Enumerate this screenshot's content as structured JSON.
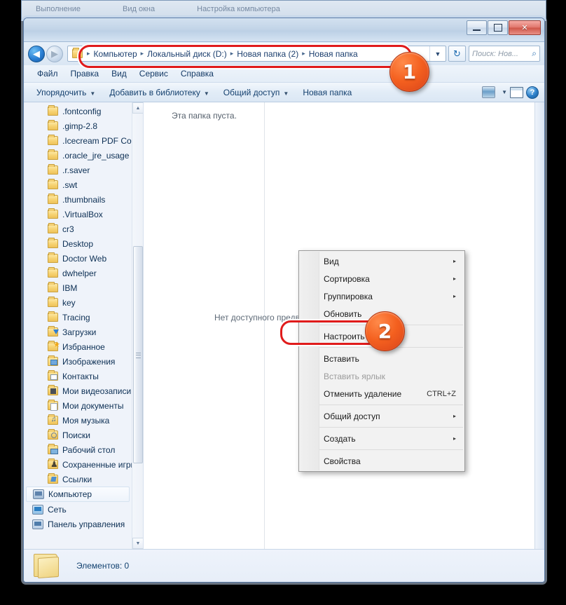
{
  "background_window": {
    "fragments": [
      "Выполнение",
      "Вид окна",
      "Настройка компьютера"
    ]
  },
  "window": {
    "controls": {
      "minimize": "minimize-button",
      "maximize": "maximize-button",
      "close": "✕"
    }
  },
  "navbar": {
    "back": "◀",
    "forward": "▶",
    "breadcrumbs": [
      "Компьютер",
      "Локальный диск (D:)",
      "Новая папка (2)",
      "Новая папка"
    ],
    "separator": "▸",
    "dropdown": "▼",
    "refresh": "↻",
    "search_placeholder": "Поиск: Нов...",
    "search_value": "",
    "search_icon": "⌕"
  },
  "menubar": [
    "Файл",
    "Правка",
    "Вид",
    "Сервис",
    "Справка"
  ],
  "commandbar": {
    "items": [
      {
        "label": "Упорядочить",
        "caret": "▼"
      },
      {
        "label": "Добавить в библиотеку",
        "caret": "▼"
      },
      {
        "label": "Общий доступ",
        "caret": "▼"
      },
      {
        "label": "Новая папка",
        "caret": ""
      }
    ],
    "view_caret": "▼",
    "help_label": "?"
  },
  "navpane": {
    "items": [
      {
        "label": ".fontconfig",
        "icon": "folder"
      },
      {
        "label": ".gimp-2.8",
        "icon": "folder"
      },
      {
        "label": ".Icecream PDF Con",
        "icon": "folder"
      },
      {
        "label": ".oracle_jre_usage",
        "icon": "folder"
      },
      {
        "label": ".r.saver",
        "icon": "folder"
      },
      {
        "label": ".swt",
        "icon": "folder"
      },
      {
        "label": ".thumbnails",
        "icon": "folder"
      },
      {
        "label": ".VirtualBox",
        "icon": "folder"
      },
      {
        "label": "cr3",
        "icon": "folder"
      },
      {
        "label": "Desktop",
        "icon": "folder"
      },
      {
        "label": "Doctor Web",
        "icon": "folder"
      },
      {
        "label": "dwhelper",
        "icon": "folder"
      },
      {
        "label": "IBM",
        "icon": "folder"
      },
      {
        "label": "key",
        "icon": "folder"
      },
      {
        "label": "Tracing",
        "icon": "folder"
      },
      {
        "label": "Загрузки",
        "icon": "downloads"
      },
      {
        "label": "Избранное",
        "icon": "favorites"
      },
      {
        "label": "Изображения",
        "icon": "pictures"
      },
      {
        "label": "Контакты",
        "icon": "contacts"
      },
      {
        "label": "Мои видеозаписи",
        "icon": "videos"
      },
      {
        "label": "Мои документы",
        "icon": "documents"
      },
      {
        "label": "Моя музыка",
        "icon": "music"
      },
      {
        "label": "Поиски",
        "icon": "searches"
      },
      {
        "label": "Рабочий стол",
        "icon": "desktop"
      },
      {
        "label": "Сохраненные игры",
        "icon": "games"
      },
      {
        "label": "Ссылки",
        "icon": "links"
      }
    ],
    "roots": [
      {
        "label": "Компьютер",
        "icon": "computer",
        "selected": true
      },
      {
        "label": "Сеть",
        "icon": "network",
        "selected": false
      },
      {
        "label": "Панель управления",
        "icon": "control-panel",
        "selected": false
      }
    ],
    "scroll_up": "▲",
    "scroll_down": "▼"
  },
  "content": {
    "empty_text": "Эта папка пуста.",
    "preview_text": "Нет доступного предварительного просмотра."
  },
  "details": {
    "item_count": "Элементов: 0"
  },
  "context_menu": {
    "items": [
      {
        "label": "Вид",
        "submenu": true,
        "disabled": false,
        "accel": ""
      },
      {
        "label": "Сортировка",
        "submenu": true,
        "disabled": false,
        "accel": ""
      },
      {
        "label": "Группировка",
        "submenu": true,
        "disabled": false,
        "accel": ""
      },
      {
        "label": "Обновить",
        "submenu": false,
        "disabled": false,
        "accel": ""
      },
      {
        "separator": true
      },
      {
        "label": "Настроить папку...",
        "submenu": false,
        "disabled": false,
        "accel": ""
      },
      {
        "separator": true
      },
      {
        "label": "Вставить",
        "submenu": false,
        "disabled": false,
        "accel": ""
      },
      {
        "label": "Вставить ярлык",
        "submenu": false,
        "disabled": true,
        "accel": ""
      },
      {
        "label": "Отменить удаление",
        "submenu": false,
        "disabled": false,
        "accel": "CTRL+Z"
      },
      {
        "separator": true
      },
      {
        "label": "Общий доступ",
        "submenu": true,
        "disabled": false,
        "accel": ""
      },
      {
        "separator": true
      },
      {
        "label": "Создать",
        "submenu": true,
        "disabled": false,
        "accel": ""
      },
      {
        "separator": true
      },
      {
        "label": "Свойства",
        "submenu": false,
        "disabled": false,
        "accel": ""
      }
    ],
    "submenu_arrow": "▸"
  },
  "annotations": {
    "badge1": "1",
    "badge2": "2",
    "accent_color": "#e01b1b",
    "badge_color": "#f4601f"
  }
}
